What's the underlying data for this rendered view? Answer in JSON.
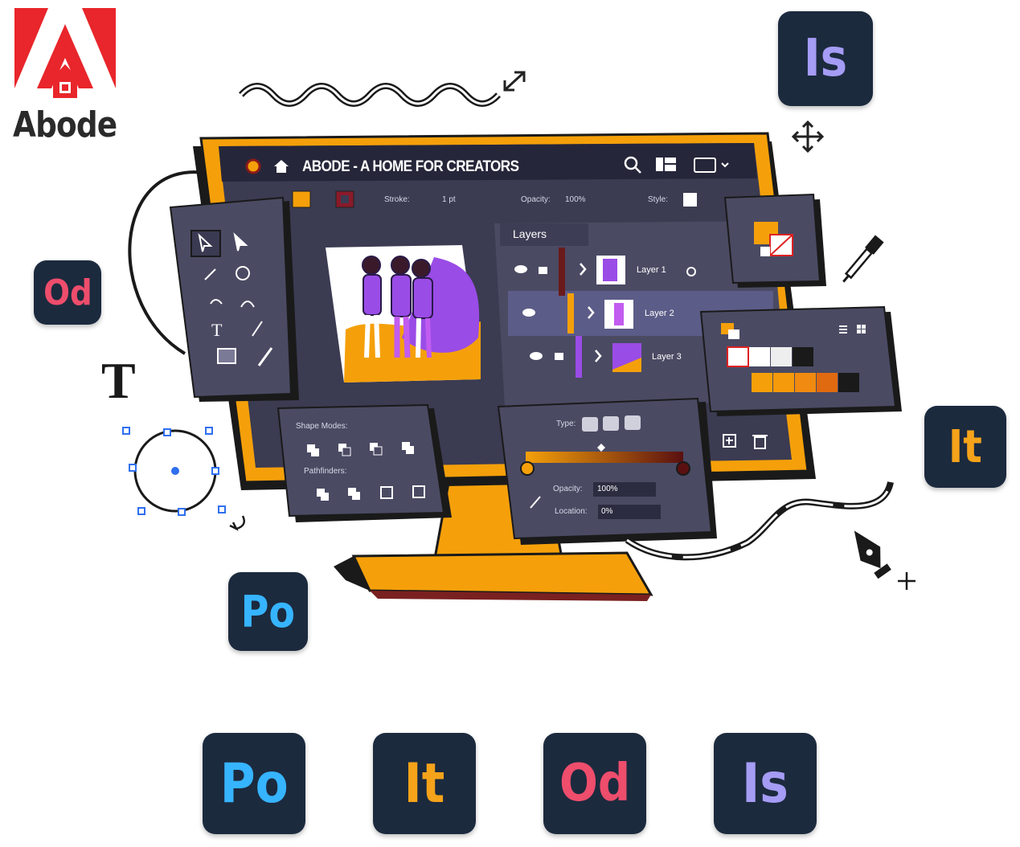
{
  "logo": {
    "text": "Abode",
    "brand_color": "#e8262b"
  },
  "window": {
    "title": "ABODE - A HOME FOR CREATORS",
    "icons": [
      "home-icon",
      "search-icon",
      "layout-icon",
      "screen-icon"
    ]
  },
  "toolbar": {
    "stroke_label": "Stroke:",
    "stroke_value": "1 pt",
    "opacity_label": "Opacity:",
    "opacity_value": "100%",
    "style_label": "Style:"
  },
  "layers": {
    "title": "Layers",
    "items": [
      {
        "label": "Layer 1"
      },
      {
        "label": "Layer 2"
      },
      {
        "label": "Layer 3"
      }
    ]
  },
  "shape_panel": {
    "shape_modes_label": "Shape Modes:",
    "pathfinders_label": "Pathfinders:"
  },
  "gradient_panel": {
    "type_label": "Type:",
    "opacity_label": "Opacity:",
    "opacity_value": "100%",
    "location_label": "Location:",
    "location_value": "0%"
  },
  "tiles": {
    "is_label": "Is",
    "od_label": "Od",
    "it_label": "It",
    "po_label": "Po"
  },
  "colors": {
    "tile_bg": "#1c2a3e",
    "is_color": "#a59cf5",
    "od_color": "#ee4d6c",
    "it_color": "#f5a31a",
    "po_color": "#36b4ff",
    "monitor_frame": "#f5a00a",
    "panel_bg": "#4a4a63",
    "screen_bg": "#3a3a52",
    "accent_purple": "#9a4ce6"
  },
  "misc": {
    "type_tool_glyph": "T"
  }
}
